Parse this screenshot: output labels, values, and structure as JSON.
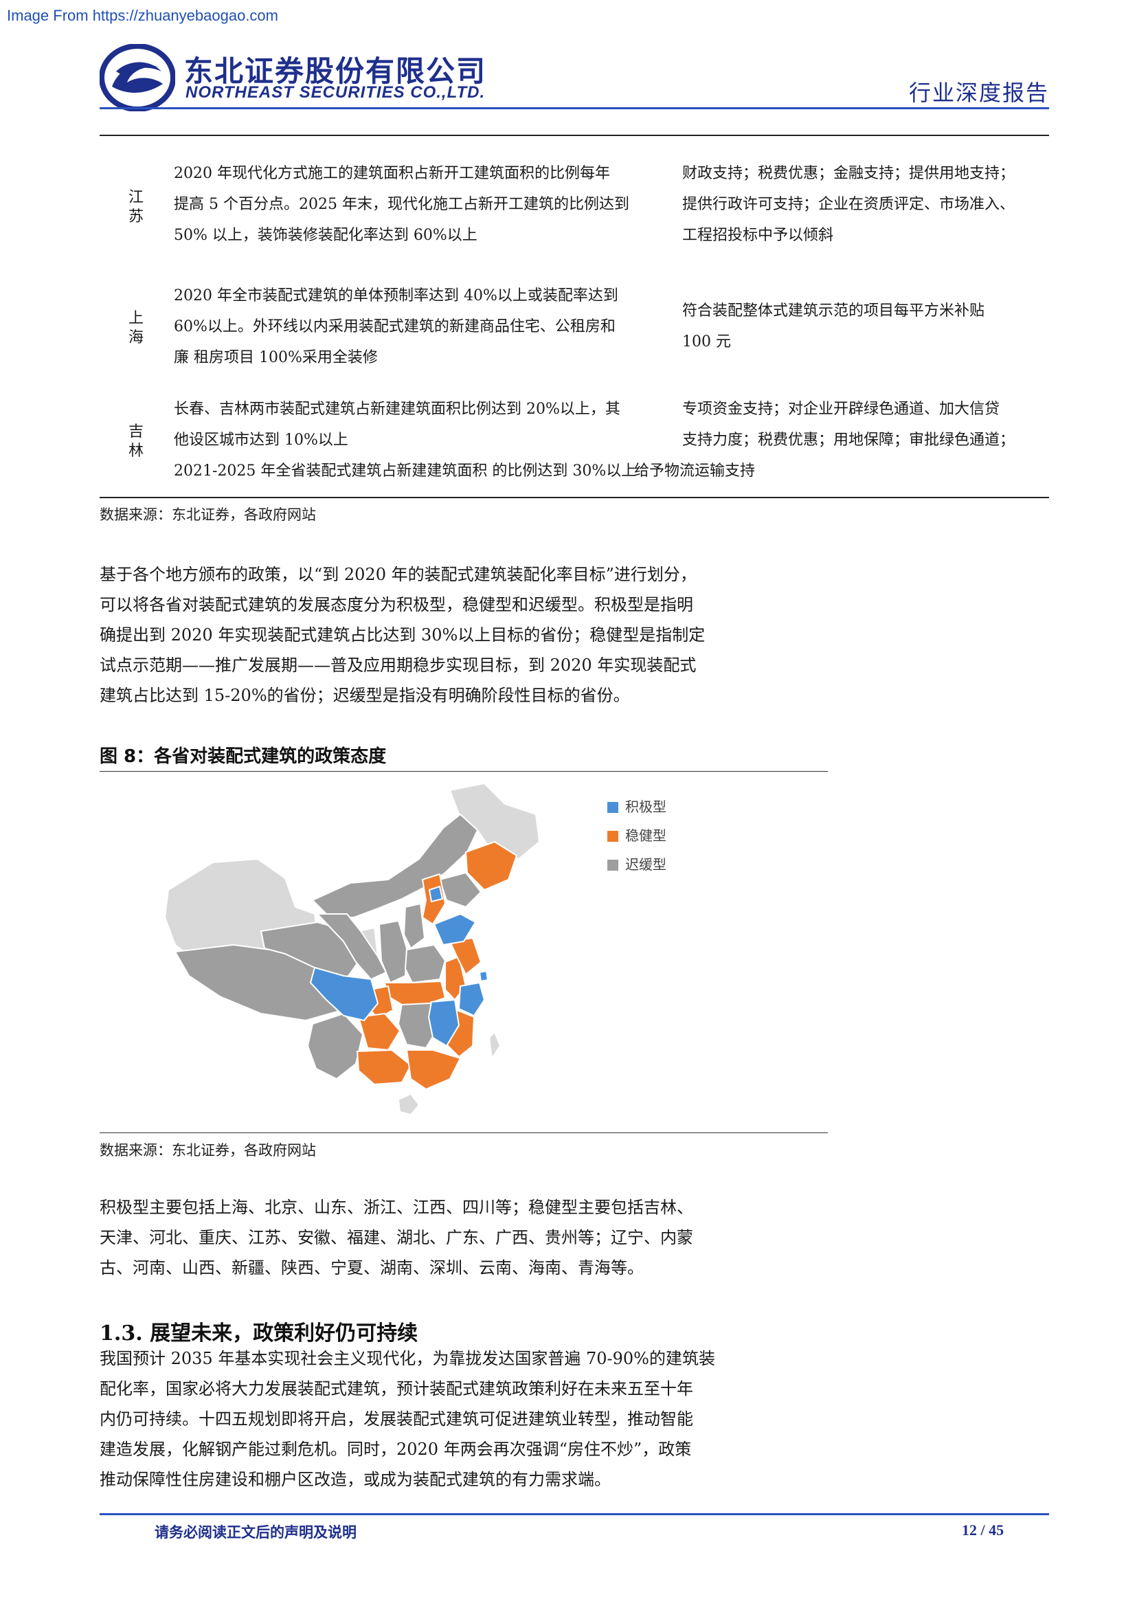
{
  "watermark": "Image From https://zhuanyebaogao.com",
  "header": {
    "company_cn": "东北证券股份有限公司",
    "company_en": "NORTHEAST SECURITIES CO.,LTD.",
    "report_type": "行业深度报告"
  },
  "table": {
    "rows": [
      {
        "province": "江苏",
        "target_lines": [
          "2020 年现代化方式施工的建筑面积占新开工建筑面积的比例每年",
          "提高 5 个百分点。2025 年末，现代化施工占新开工建筑的比例达到",
          "50%  以上，装饰装修装配化率达到 60%以上"
        ],
        "support_lines": [
          "财政支持；税费优惠；金融支持；提供用地支持；",
          "提供行政许可支持；企业在资质评定、市场准入、",
          "工程招投标中予以倾斜"
        ]
      },
      {
        "province": "上海",
        "target_lines": [
          "2020  年全市装配式建筑的单体预制率达到  40%以上或装配率达到",
          "60%以上。外环线以内采用装配式建筑的新建商品住宅、公租房和",
          "廉  租房项目 100%采用全装修"
        ],
        "support_lines": [
          "符合装配整体式建筑示范的项目每平方米补贴",
          "100  元"
        ]
      },
      {
        "province": "吉林",
        "target_lines": [
          "长春、吉林两市装配式建筑占新建建筑面积比例达到 20%以上，其",
          "他设区城市达到 10%以上",
          "2021-2025 年全省装配式建筑占新建建筑面积  的比例达到 30%以上"
        ],
        "support_lines": [
          "专项资金支持；对企业开辟绿色通道、加大信贷",
          "支持力度；税费优惠；用地保障；审批绿色通道；",
          "给予物流运输支持"
        ]
      }
    ],
    "source": "数据来源：东北证券，各政府网站"
  },
  "paragraph1": [
    "基于各个地方颁布的政策，以“到 2020 年的装配式建筑装配化率目标”进行划分，",
    "可以将各省对装配式建筑的发展态度分为积极型，稳健型和迟缓型。积极型是指明",
    "确提出到 2020 年实现装配式建筑占比达到 30%以上目标的省份；稳健型是指制定",
    "试点示范期——推广发展期——普及应用期稳步实现目标，到 2020 年实现装配式",
    "建筑占比达到 15-20%的省份；迟缓型是指没有明确阶段性目标的省份。"
  ],
  "figure": {
    "title": "图 8：各省对装配式建筑的政策态度",
    "legend": [
      {
        "label": "积极型",
        "color": "#4a90d9"
      },
      {
        "label": "稳健型",
        "color": "#ee7b2a"
      },
      {
        "label": "迟缓型",
        "color": "#9e9e9e"
      }
    ],
    "colors": {
      "light": "#d9d9d9",
      "mid": "#9e9e9e",
      "blue": "#4a90d9",
      "orange": "#ee7b2a"
    },
    "source": "数据来源：东北证券，各政府网站"
  },
  "paragraph2": [
    "积极型主要包括上海、北京、山东、浙江、江西、四川等；稳健型主要包括吉林、",
    "天津、河北、重庆、江苏、安徽、福建、湖北、广东、广西、贵州等；辽宁、内蒙",
    "古、河南、山西、新疆、陕西、宁夏、湖南、深圳、云南、海南、青海等。"
  ],
  "section": {
    "title": "1.3.   展望未来，政策利好仍可持续",
    "lines": [
      "我国预计 2035 年基本实现社会主义现代化，为靠拢发达国家普遍 70-90%的建筑装",
      "配化率，国家必将大力发展装配式建筑，预计装配式建筑政策利好在未来五至十年",
      "内仍可持续。十四五规划即将开启，发展装配式建筑可促进建筑业转型，推动智能",
      "建造发展，化解钢产能过剩危机。同时，2020 年两会再次强调“房住不炒”，政策",
      "推动保障性住房建设和棚户区改造，或成为装配式建筑的有力需求端。"
    ]
  },
  "footer": {
    "note": "请务必阅读正文后的声明及说明",
    "page": "12 / 45"
  }
}
